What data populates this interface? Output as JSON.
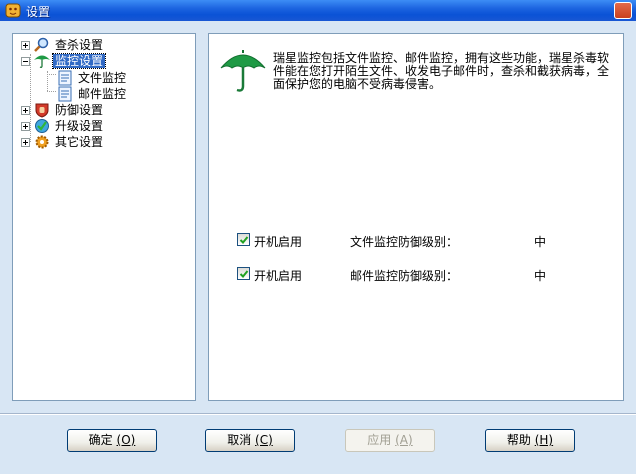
{
  "window": {
    "title": "设置"
  },
  "tree": {
    "items": [
      {
        "label": "查杀设置",
        "icon": "magnifier-icon",
        "expanded": false
      },
      {
        "label": "监控设置",
        "icon": "umbrella-icon",
        "expanded": true,
        "selected": true,
        "children": [
          {
            "label": "文件监控",
            "icon": "document-icon"
          },
          {
            "label": "邮件监控",
            "icon": "document-icon"
          }
        ]
      },
      {
        "label": "防御设置",
        "icon": "shield-hand-icon",
        "expanded": false
      },
      {
        "label": "升级设置",
        "icon": "update-globe-icon",
        "expanded": false
      },
      {
        "label": "其它设置",
        "icon": "gear-icon",
        "expanded": false
      }
    ]
  },
  "content": {
    "description": "瑞星监控包括文件监控、邮件监控，拥有这些功能，瑞星杀毒软件能在您打开陌生文件、收发电子邮件时，查杀和截获病毒，全面保护您的电脑不受病毒侵害。",
    "options": [
      {
        "checkbox_label": "开机启用",
        "checked": true,
        "level_label": "文件监控防御级别：",
        "level_value": "中"
      },
      {
        "checkbox_label": "开机启用",
        "checked": true,
        "level_label": "邮件监控防御级别：",
        "level_value": "中"
      }
    ]
  },
  "buttons": {
    "ok": {
      "label": "确定",
      "key": "(O)"
    },
    "cancel": {
      "label": "取消",
      "key": "(C)"
    },
    "apply": {
      "label": "应用",
      "key": "(A)"
    },
    "help": {
      "label": "帮助",
      "key": "(H)"
    }
  },
  "colors": {
    "accent": "#0a52d6",
    "panel_bg": "#d8e6f4",
    "selection": "#316ac5",
    "umbrella": "#1f9a45"
  }
}
